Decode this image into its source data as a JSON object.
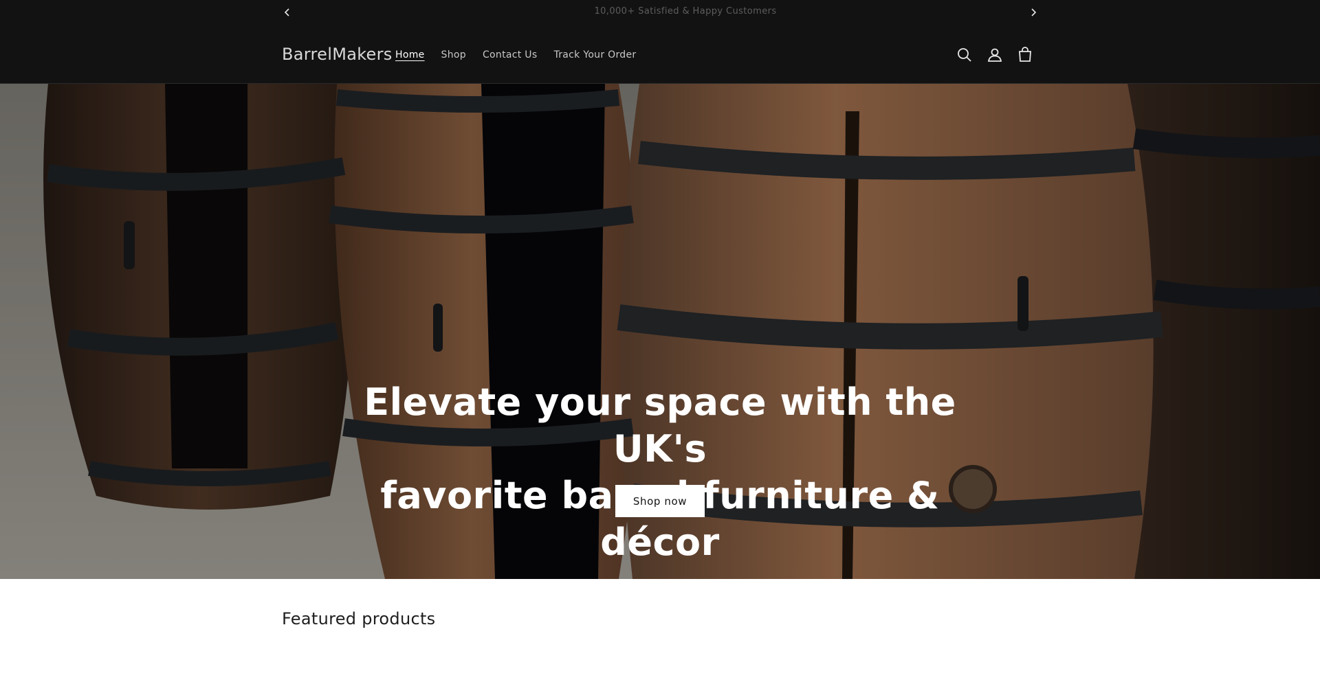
{
  "announcement": {
    "message": "10,000+ Satisfied & Happy Customers",
    "prev_icon": "chevron-left-icon",
    "next_icon": "chevron-right-icon"
  },
  "header": {
    "logo": "BarrelMakers",
    "nav": [
      {
        "label": "Home",
        "active": true
      },
      {
        "label": "Shop",
        "active": false
      },
      {
        "label": "Contact Us",
        "active": false
      },
      {
        "label": "Track Your Order",
        "active": false
      }
    ],
    "icons": [
      "search-icon",
      "account-icon",
      "cart-icon"
    ]
  },
  "hero": {
    "headline_line1": "Elevate your space with the UK's",
    "headline_line2": "favorite barrel furniture & décor",
    "button_label": "Shop now"
  },
  "featured": {
    "title": "Featured products"
  },
  "colors": {
    "header_bg": "#121212",
    "button_bg": "#ffffff",
    "wood": "#8a5a3a",
    "iron": "#2b2e31"
  }
}
